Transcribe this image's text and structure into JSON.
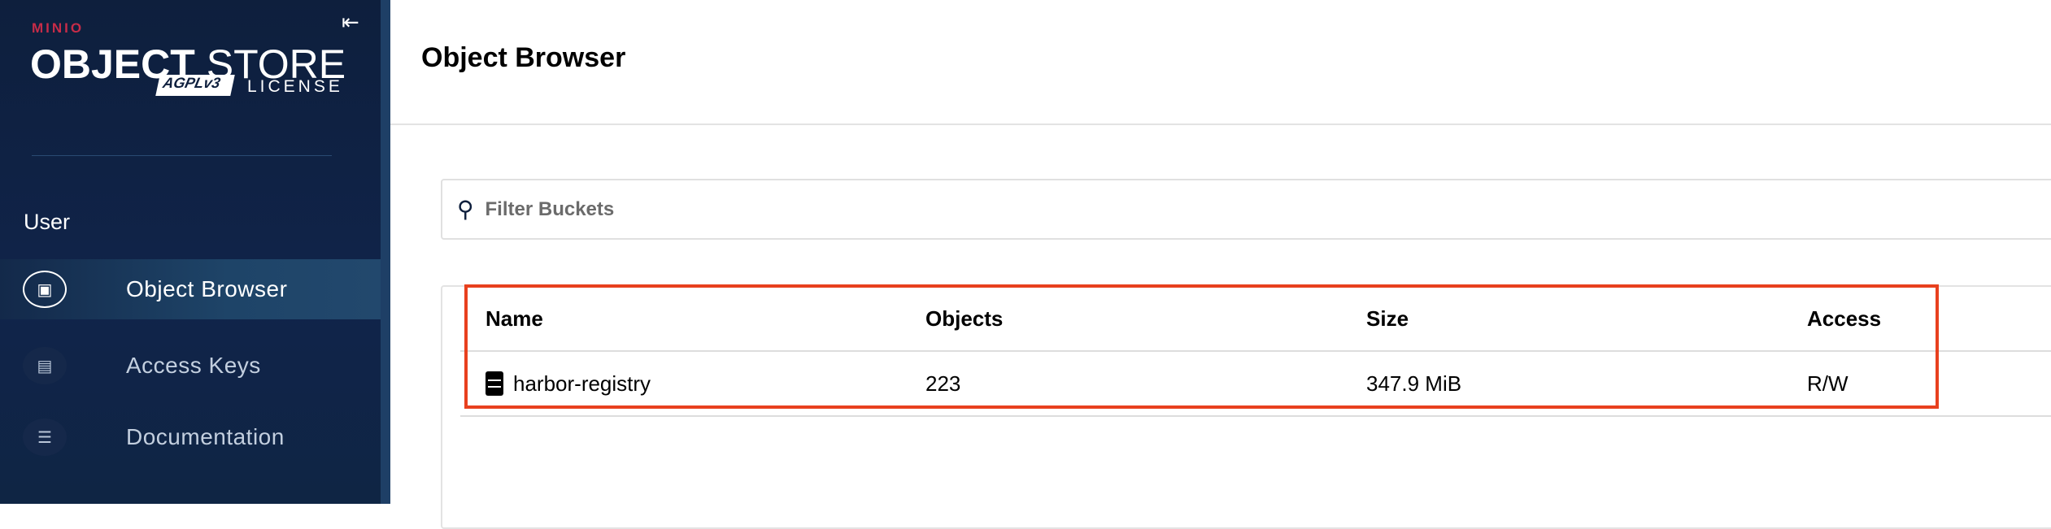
{
  "sidebar": {
    "logo": {
      "brand": "MINIO",
      "product_bold": "OBJECT",
      "product_light": "STORE",
      "license_badge": "AGPLv3",
      "license_label": "LICENSE"
    },
    "section_label": "User",
    "items": [
      {
        "label": "Object Browser",
        "active": true
      },
      {
        "label": "Access Keys",
        "active": false
      },
      {
        "label": "Documentation",
        "active": false
      }
    ]
  },
  "header": {
    "title": "Object Browser"
  },
  "search": {
    "placeholder": "Filter Buckets",
    "value": ""
  },
  "table": {
    "columns": [
      "Name",
      "Objects",
      "Size",
      "Access"
    ],
    "rows": [
      {
        "name": "harbor-registry",
        "objects": "223",
        "size": "347.9 MiB",
        "access": "R/W"
      }
    ]
  },
  "colors": {
    "sidebar": "#0e1f3d",
    "brand_red": "#c72c48",
    "highlight": "#e8401e"
  }
}
